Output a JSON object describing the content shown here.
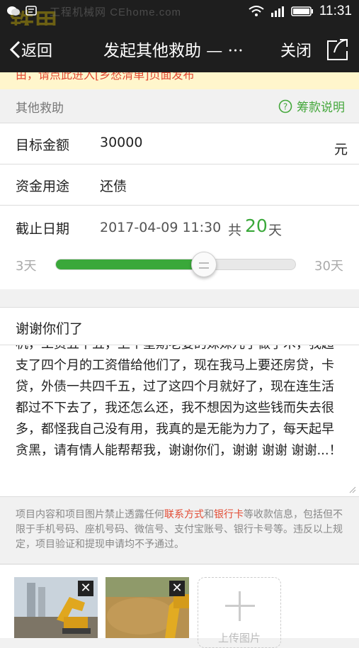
{
  "status_bar": {
    "time": "11:31",
    "watermark": "工程机械网",
    "watermark_url": "CEhome.com"
  },
  "nav": {
    "back_label": "返回",
    "title": "发起其他救助 — ···",
    "close_label": "关闭"
  },
  "banner": {
    "text": "由，请点此进入[乡愁清单]页面发布"
  },
  "section": {
    "label": "其他救助",
    "help_label": "筹款说明",
    "accent_color": "#44a73b"
  },
  "form": {
    "target_amount": {
      "label": "目标金额",
      "value": "30000",
      "unit": "元"
    },
    "purpose": {
      "label": "资金用途",
      "value": "还债"
    },
    "deadline": {
      "label": "截止日期",
      "date": "2017-04-09 11:30",
      "total_prefix": "共",
      "days": "20",
      "days_unit": "天",
      "slider_min_label": "3天",
      "slider_max_label": "30天",
      "slider_value_days": 20,
      "slider_min_days": 3,
      "slider_max_days": 30
    }
  },
  "story": {
    "title": "谢谢你们了",
    "body": "机，工资五千五，上个星期老婆的妹妹儿子做手术，我超支了四个月的工资借给他们了，现在我马上要还房贷，卡贷，外债一共四千五，过了这四个月就好了，现在连生活都过不下去了，我还怎么还，我不想因为这些钱而失去很多，都怪我自己没有用，我真的是无能为力了，每天起早贪黑，请有情人能帮帮我，谢谢你们，谢谢 谢谢 谢谢...！"
  },
  "notice": {
    "part1": "项目内容和项目图片禁止透露任何",
    "link1": "联系方式",
    "and": "和",
    "link2": "银行卡",
    "part2": "等收款信息，包括但不限于手机号码、座机号码、微信号、支付宝账号、银行卡号等。违反以上规定，项目验证和提现申请均不予通过。"
  },
  "photos": {
    "delete_glyph": "✕",
    "upload_label": "上传图片"
  }
}
